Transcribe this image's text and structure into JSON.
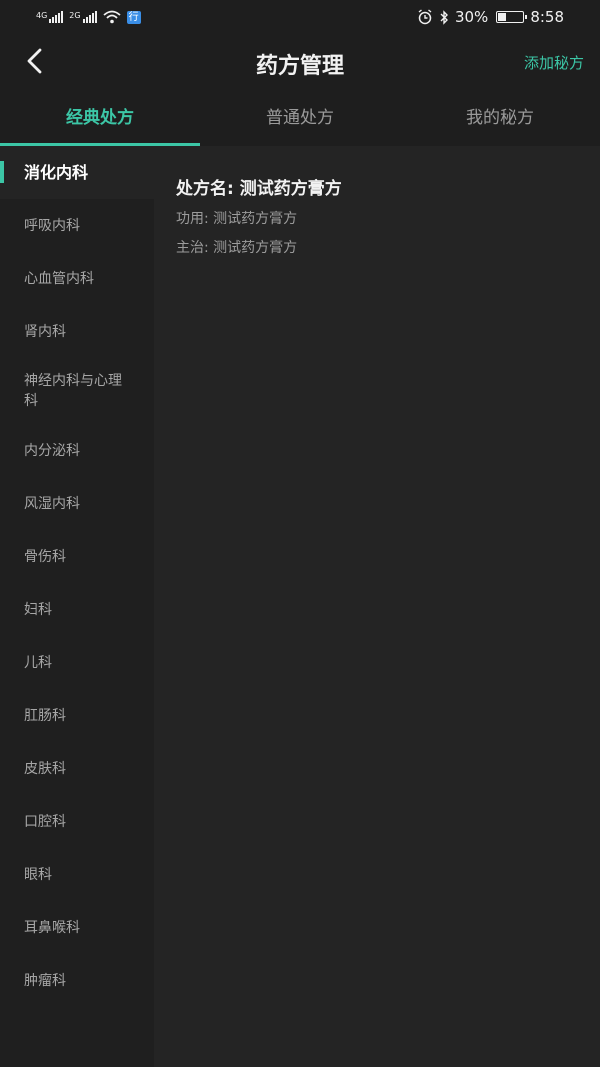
{
  "status_bar": {
    "signal1_label": "4G",
    "signal2_label": "2G",
    "badge": "行",
    "battery_text": "30%",
    "battery_level": 0.3,
    "time": "8:58"
  },
  "header": {
    "title": "药方管理",
    "add_label": "添加秘方"
  },
  "tabs": [
    {
      "label": "经典处方"
    },
    {
      "label": "普通处方"
    },
    {
      "label": "我的秘方"
    }
  ],
  "sidebar": {
    "items": [
      {
        "label": "消化内科"
      },
      {
        "label": "呼吸内科"
      },
      {
        "label": "心血管内科"
      },
      {
        "label": "肾内科"
      },
      {
        "label": "神经内科与心理科"
      },
      {
        "label": "内分泌科"
      },
      {
        "label": "风湿内科"
      },
      {
        "label": "骨伤科"
      },
      {
        "label": "妇科"
      },
      {
        "label": "儿科"
      },
      {
        "label": "肛肠科"
      },
      {
        "label": "皮肤科"
      },
      {
        "label": "口腔科"
      },
      {
        "label": "眼科"
      },
      {
        "label": "耳鼻喉科"
      },
      {
        "label": "肿瘤科"
      }
    ]
  },
  "prescription": {
    "name": "处方名: 测试药方膏方",
    "effect": "功用: 测试药方膏方",
    "indication": "主治: 测试药方膏方"
  },
  "colors": {
    "accent": "#3cc6a6",
    "background": "#242424",
    "bar": "#1e1e1e"
  }
}
